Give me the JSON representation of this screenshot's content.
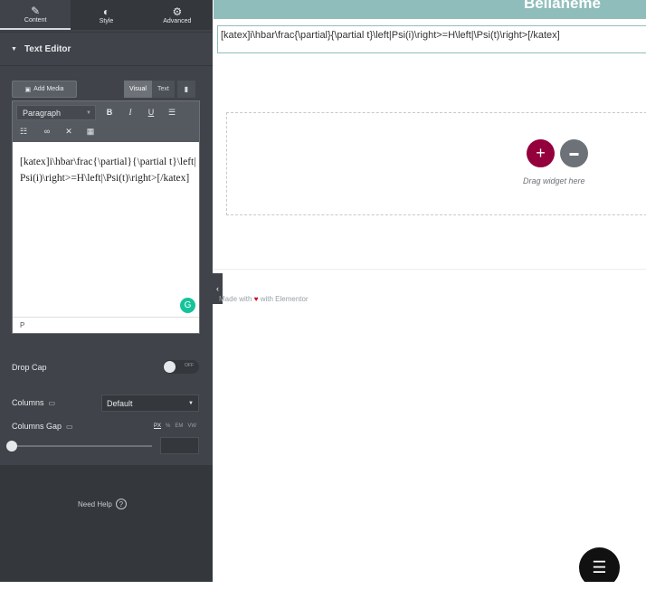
{
  "panel": {
    "tabs": [
      {
        "label": "Content",
        "icon": "pencil-icon",
        "glyph": "✎"
      },
      {
        "label": "Style",
        "icon": "half-circle-icon",
        "glyph": "◐"
      },
      {
        "label": "Advanced",
        "icon": "gear-icon",
        "glyph": "⚙"
      }
    ],
    "section_title": "Text Editor",
    "add_media": "Add Media",
    "mode_visual": "Visual",
    "mode_text": "Text",
    "format_select": "Paragraph",
    "editor_content": "[katex]i\\hbar\\frac{\\partial}{\\partial t}\\left|Psi(i)\\right>=H\\left|\\Psi(t)\\right>[/katex]",
    "path_indicator": "P",
    "drop_cap_label": "Drop Cap",
    "drop_cap_state": "OFF",
    "columns_label": "Columns",
    "columns_value": "Default",
    "columns_gap_label": "Columns Gap",
    "units": [
      "PX",
      "%",
      "EM",
      "VW"
    ],
    "need_help": "Need Help",
    "help_glyph": "?"
  },
  "canvas": {
    "site_title": "Bellaheme",
    "shortcode_text": "[katex]i\\hbar\\frac{\\partial}{\\partial t}\\left|Psi(i)\\right>=H\\left|\\Psi(t)\\right>[/katex]",
    "add_glyph": "+",
    "drag_widget": "Drag widget here",
    "footer_prefix": "Made with",
    "footer_suffix": "with Elementor",
    "heart": "♥"
  },
  "colors": {
    "accent": "#93003c",
    "header": "#8fbdbb",
    "panel": "#404349"
  }
}
